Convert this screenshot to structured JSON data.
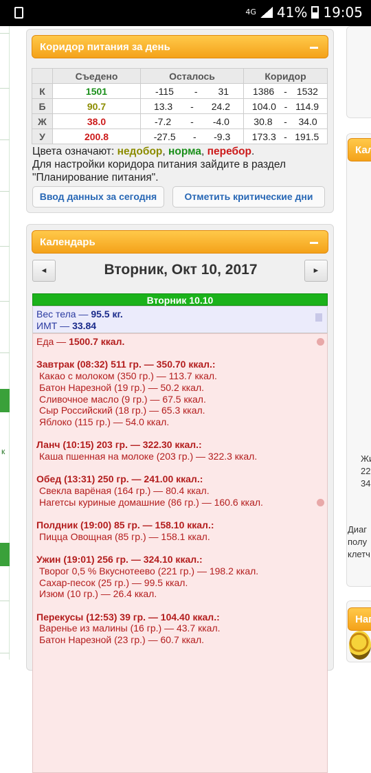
{
  "status_bar": {
    "network": "4G",
    "battery": "41%",
    "time": "19:05"
  },
  "nutrition_panel": {
    "title": "Коридор питания за день",
    "headers": [
      "Съедено",
      "Осталось",
      "Коридор"
    ],
    "rows": [
      {
        "label": "К",
        "eaten": "1501",
        "left_min": "-115",
        "left_max": "31",
        "range_min": "1386",
        "range_max": "1532",
        "color": "#1a8f1a"
      },
      {
        "label": "Б",
        "eaten": "90.7",
        "left_min": "13.3",
        "left_max": "24.2",
        "range_min": "104.0",
        "range_max": "114.9",
        "color": "#8c8c00"
      },
      {
        "label": "Ж",
        "eaten": "38.0",
        "left_min": "-7.2",
        "left_max": "-4.0",
        "range_min": "30.8",
        "range_max": "34.0",
        "color": "#cc1a1a"
      },
      {
        "label": "У",
        "eaten": "200.8",
        "left_min": "-27.5",
        "left_max": "-9.3",
        "range_min": "173.3",
        "range_max": "191.5",
        "color": "#cc1a1a"
      }
    ],
    "dash": "-",
    "legend": {
      "prefix": "Цвета означают: ",
      "under": "недобор",
      "sep1": ", ",
      "norm": "норма",
      "sep2": ", ",
      "over": "перебор",
      "end": ".",
      "colors": {
        "under": "#8c8c00",
        "norm": "#1a8f1a",
        "over": "#cc1a1a"
      }
    },
    "settings_note": "Для настройки коридора питания зайдите в раздел \"Планирование питания\".",
    "buttons": {
      "enter_today": "Ввод данных за сегодня",
      "mark_critical": "Отметить критические дни"
    }
  },
  "calendar_panel": {
    "title": "Календарь",
    "prev": "◄",
    "next": "►",
    "date_title": "Вторник, Окт 10, 2017",
    "day_label": "Вторник 10.10",
    "weight_label": "Вес тела — ",
    "weight_value": "95.5 кг.",
    "bmi_label": "ИМТ — ",
    "bmi_value": "33.84",
    "food_total_label": "Еда — ",
    "food_total_value": "1500.7 ккал.",
    "meals": [
      {
        "title": "Завтрак (08:32) 511 гр. — 350.70 ккал.:",
        "items": [
          "Какао с молоком (350 гр.) — 113.7 ккал.",
          "Батон Нарезной (19 гр.) — 50.2 ккал.",
          "Сливочное масло (9 гр.) — 67.5 ккал.",
          "Сыр Российский (18 гр.) — 65.3 ккал.",
          "Яблоко (115 гр.) — 54.0 ккал."
        ]
      },
      {
        "title": "Ланч (10:15) 203 гр. — 322.30 ккал.:",
        "items": [
          "Каша пшенная на молоке (203 гр.) — 322.3 ккал."
        ]
      },
      {
        "title": "Обед (13:31) 250 гр. — 241.00 ккал.:",
        "items": [
          "Свекла варёная (164 гр.) — 80.4 ккал.",
          "Нагетсы куриные домашние (86 гр.) — 160.6 ккал."
        ]
      },
      {
        "title": "Полдник (19:00) 85 гр. — 158.10 ккал.:",
        "items": [
          "Пицца Овощная (85 гр.) — 158.1 ккал."
        ]
      },
      {
        "title": "Ужин (19:01) 256 гр. — 324.10 ккал.:",
        "items": [
          "Творог 0,5 % Вкуснотеево (221 гр.) — 198.2 ккал.",
          "Сахар-песок (25 гр.) — 99.5 ккал.",
          "Изюм (10 гр.) — 26.4 ккал."
        ]
      },
      {
        "title": "Перекусы (12:53) 39 гр. — 104.40 ккал.:",
        "items": [
          "Варенье из малины (16 гр.) — 43.7 ккал.",
          "Батон Нарезной (23 гр.) — 60.7 ккал."
        ]
      }
    ]
  },
  "right_column": {
    "header1": "Кал",
    "text_zh": "Жи",
    "text_22": "22",
    "text_34": "34",
    "text_diag": "Диаг",
    "text_polu": "полу",
    "text_kletch": "клетч",
    "header2": "Нап"
  },
  "left_column": {
    "k_text": "к"
  }
}
